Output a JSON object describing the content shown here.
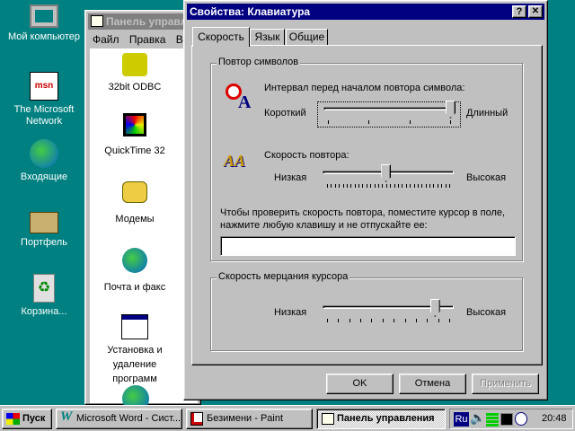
{
  "desktop": {
    "icons": [
      {
        "label": "Мой компьютер",
        "icon": "my-computer-icon"
      },
      {
        "label": "The Microsoft Network",
        "icon": "msn-icon"
      },
      {
        "label": "Входящие",
        "icon": "inbox-icon"
      },
      {
        "label": "Портфель",
        "icon": "briefcase-icon"
      },
      {
        "label": "Корзина...",
        "icon": "recycle-bin-icon"
      }
    ]
  },
  "control_panel": {
    "title": "Панель управл",
    "menu": [
      "Файл",
      "Правка",
      "Ви"
    ],
    "items": [
      {
        "label": "32bit ODBC"
      },
      {
        "label": "QuickTime 32"
      },
      {
        "label": "Модемы"
      },
      {
        "label": "Почта и факс"
      },
      {
        "label": "Установка и удаление программ"
      }
    ]
  },
  "dialog": {
    "title": "Свойства: Клавиатура",
    "help": "?",
    "close": "✕",
    "tabs": [
      "Скорость",
      "Язык",
      "Общие"
    ],
    "active_tab": "Скорость",
    "repeat_group": {
      "legend": "Повтор символов",
      "delay_label": "Интервал перед началом повтора символа:",
      "delay_min": "Короткий",
      "delay_max": "Длинный",
      "delay_value": 1.0,
      "rate_label": "Скорость повтора:",
      "rate_min": "Низкая",
      "rate_max": "Высокая",
      "rate_value": 0.48,
      "test_label": "Чтобы проверить скорость повтора, поместите курсор в поле, нажмите любую клавишу и не отпускайте ее:",
      "test_value": ""
    },
    "blink_group": {
      "legend": "Скорость мерцания курсора",
      "min": "Низкая",
      "max": "Высокая",
      "value": 0.88
    },
    "buttons": {
      "ok": "OK",
      "cancel": "Отмена",
      "apply": "Применить"
    }
  },
  "taskbar": {
    "start": "Пуск",
    "tasks": [
      {
        "label": "Microsoft Word - Сист..."
      },
      {
        "label": "Безимени - Paint"
      },
      {
        "label": "Панель управления",
        "active": true
      }
    ],
    "lang": "Ru",
    "clock": "20:48"
  },
  "colors": {
    "desktop": "#008080",
    "title_active": "#000080",
    "title_inactive": "#808080",
    "face": "#c0c0c0"
  }
}
